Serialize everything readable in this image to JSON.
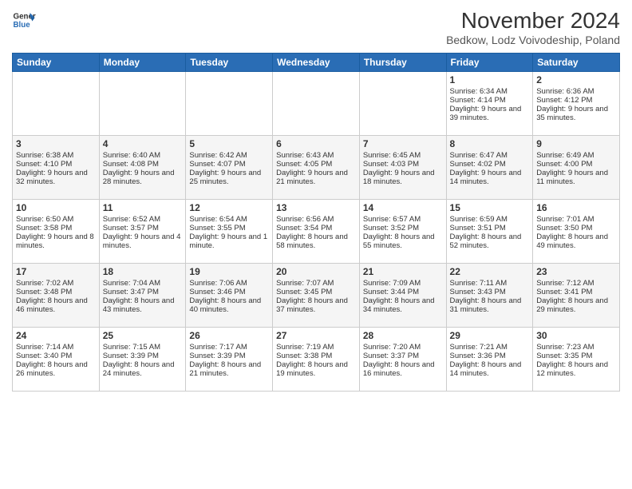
{
  "logo": {
    "line1": "General",
    "line2": "Blue"
  },
  "title": "November 2024",
  "subtitle": "Bedkow, Lodz Voivodeship, Poland",
  "days_header": [
    "Sunday",
    "Monday",
    "Tuesday",
    "Wednesday",
    "Thursday",
    "Friday",
    "Saturday"
  ],
  "weeks": [
    [
      {
        "day": "",
        "info": ""
      },
      {
        "day": "",
        "info": ""
      },
      {
        "day": "",
        "info": ""
      },
      {
        "day": "",
        "info": ""
      },
      {
        "day": "",
        "info": ""
      },
      {
        "day": "1",
        "info": "Sunrise: 6:34 AM\nSunset: 4:14 PM\nDaylight: 9 hours and 39 minutes."
      },
      {
        "day": "2",
        "info": "Sunrise: 6:36 AM\nSunset: 4:12 PM\nDaylight: 9 hours and 35 minutes."
      }
    ],
    [
      {
        "day": "3",
        "info": "Sunrise: 6:38 AM\nSunset: 4:10 PM\nDaylight: 9 hours and 32 minutes."
      },
      {
        "day": "4",
        "info": "Sunrise: 6:40 AM\nSunset: 4:08 PM\nDaylight: 9 hours and 28 minutes."
      },
      {
        "day": "5",
        "info": "Sunrise: 6:42 AM\nSunset: 4:07 PM\nDaylight: 9 hours and 25 minutes."
      },
      {
        "day": "6",
        "info": "Sunrise: 6:43 AM\nSunset: 4:05 PM\nDaylight: 9 hours and 21 minutes."
      },
      {
        "day": "7",
        "info": "Sunrise: 6:45 AM\nSunset: 4:03 PM\nDaylight: 9 hours and 18 minutes."
      },
      {
        "day": "8",
        "info": "Sunrise: 6:47 AM\nSunset: 4:02 PM\nDaylight: 9 hours and 14 minutes."
      },
      {
        "day": "9",
        "info": "Sunrise: 6:49 AM\nSunset: 4:00 PM\nDaylight: 9 hours and 11 minutes."
      }
    ],
    [
      {
        "day": "10",
        "info": "Sunrise: 6:50 AM\nSunset: 3:58 PM\nDaylight: 9 hours and 8 minutes."
      },
      {
        "day": "11",
        "info": "Sunrise: 6:52 AM\nSunset: 3:57 PM\nDaylight: 9 hours and 4 minutes."
      },
      {
        "day": "12",
        "info": "Sunrise: 6:54 AM\nSunset: 3:55 PM\nDaylight: 9 hours and 1 minute."
      },
      {
        "day": "13",
        "info": "Sunrise: 6:56 AM\nSunset: 3:54 PM\nDaylight: 8 hours and 58 minutes."
      },
      {
        "day": "14",
        "info": "Sunrise: 6:57 AM\nSunset: 3:52 PM\nDaylight: 8 hours and 55 minutes."
      },
      {
        "day": "15",
        "info": "Sunrise: 6:59 AM\nSunset: 3:51 PM\nDaylight: 8 hours and 52 minutes."
      },
      {
        "day": "16",
        "info": "Sunrise: 7:01 AM\nSunset: 3:50 PM\nDaylight: 8 hours and 49 minutes."
      }
    ],
    [
      {
        "day": "17",
        "info": "Sunrise: 7:02 AM\nSunset: 3:48 PM\nDaylight: 8 hours and 46 minutes."
      },
      {
        "day": "18",
        "info": "Sunrise: 7:04 AM\nSunset: 3:47 PM\nDaylight: 8 hours and 43 minutes."
      },
      {
        "day": "19",
        "info": "Sunrise: 7:06 AM\nSunset: 3:46 PM\nDaylight: 8 hours and 40 minutes."
      },
      {
        "day": "20",
        "info": "Sunrise: 7:07 AM\nSunset: 3:45 PM\nDaylight: 8 hours and 37 minutes."
      },
      {
        "day": "21",
        "info": "Sunrise: 7:09 AM\nSunset: 3:44 PM\nDaylight: 8 hours and 34 minutes."
      },
      {
        "day": "22",
        "info": "Sunrise: 7:11 AM\nSunset: 3:43 PM\nDaylight: 8 hours and 31 minutes."
      },
      {
        "day": "23",
        "info": "Sunrise: 7:12 AM\nSunset: 3:41 PM\nDaylight: 8 hours and 29 minutes."
      }
    ],
    [
      {
        "day": "24",
        "info": "Sunrise: 7:14 AM\nSunset: 3:40 PM\nDaylight: 8 hours and 26 minutes."
      },
      {
        "day": "25",
        "info": "Sunrise: 7:15 AM\nSunset: 3:39 PM\nDaylight: 8 hours and 24 minutes."
      },
      {
        "day": "26",
        "info": "Sunrise: 7:17 AM\nSunset: 3:39 PM\nDaylight: 8 hours and 21 minutes."
      },
      {
        "day": "27",
        "info": "Sunrise: 7:19 AM\nSunset: 3:38 PM\nDaylight: 8 hours and 19 minutes."
      },
      {
        "day": "28",
        "info": "Sunrise: 7:20 AM\nSunset: 3:37 PM\nDaylight: 8 hours and 16 minutes."
      },
      {
        "day": "29",
        "info": "Sunrise: 7:21 AM\nSunset: 3:36 PM\nDaylight: 8 hours and 14 minutes."
      },
      {
        "day": "30",
        "info": "Sunrise: 7:23 AM\nSunset: 3:35 PM\nDaylight: 8 hours and 12 minutes."
      }
    ]
  ]
}
